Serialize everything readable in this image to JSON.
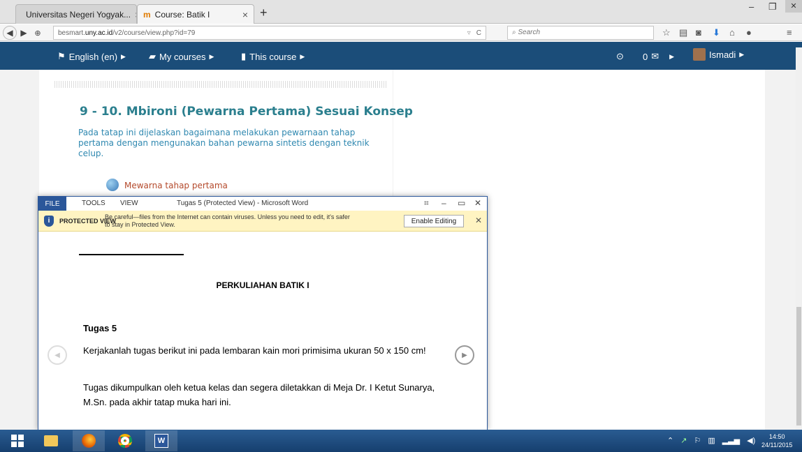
{
  "browser": {
    "tabs": [
      {
        "label": "Universitas Negeri Yogyak...",
        "icon": "globe-icon"
      },
      {
        "label": "Course: Batik I",
        "icon": "moodle-icon"
      }
    ],
    "url_prefix": "besmart.",
    "url_host": "uny.ac.id",
    "url_path": "/v2/course/view.php?id=79",
    "search_placeholder": "Search"
  },
  "moodle_nav": {
    "language": "English (en)",
    "my_courses": "My courses",
    "this_course": "This course",
    "messages_count": "0",
    "user": "Ismadi"
  },
  "course": {
    "section_title": "9 - 10. Mbironi (Pewarna Pertama) Sesuai Konsep",
    "section_desc": "Pada tatap ini dijelaskan bagaimana melakukan pewarnaan tahap pertama dengan mengunakan bahan pewarna sintetis dengan teknik celup.",
    "resource_link": "Mewarna tahap pertama"
  },
  "word": {
    "menu_file": "FILE",
    "menu_tools": "TOOLS",
    "menu_view": "VIEW",
    "title": "Tugas 5 (Protected View) - Microsoft Word",
    "pv_label": "PROTECTED VIEW",
    "pv_message": "Be careful—files from the Internet can contain viruses. Unless you need to edit, it's safer to stay in Protected View.",
    "pv_button": "Enable Editing",
    "doc_heading": "PERKULIAHAN BATIK I",
    "doc_subheading": "Tugas 5",
    "doc_para1": "Kerjakanlah tugas berikut ini pada lembaran kain mori primisima ukuran 50 x 150 cm!",
    "doc_para2": "Tugas dikumpulkan oleh ketua kelas dan segera diletakkan di Meja Dr. I Ketut Sunarya, M.Sn. pada akhir tatap muka hari ini."
  },
  "taskbar": {
    "time": "14:50",
    "date": "24/11/2015"
  },
  "colors": {
    "moodle_nav_bg": "#1b4d79",
    "section_title": "#2b7f8e",
    "word_blue": "#2b579a",
    "protected_bar": "#fff4c2"
  }
}
